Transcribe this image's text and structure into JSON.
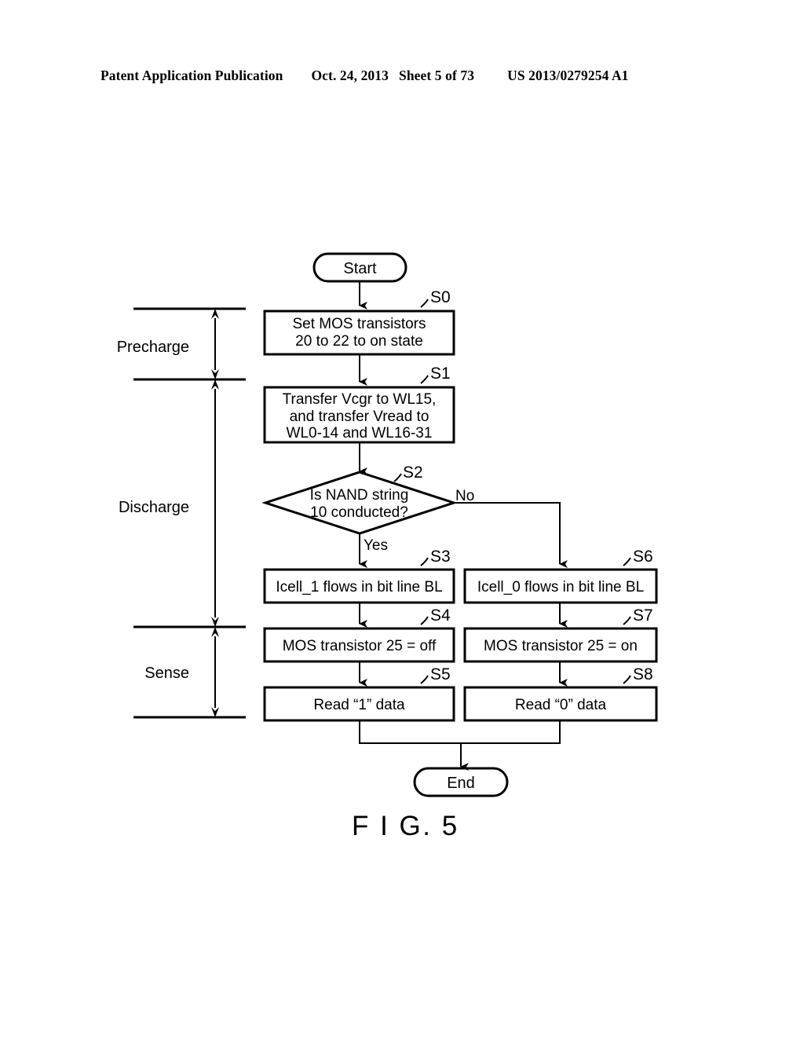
{
  "header": {
    "publication": "Patent Application Publication",
    "date": "Oct. 24, 2013",
    "sheet": "Sheet 5 of 73",
    "patent_number": "US 2013/0279254 A1"
  },
  "figure": {
    "caption": "F I G. 5",
    "colors": {
      "ink": "#000000",
      "background": "#ffffff"
    },
    "phases": [
      {
        "id": "precharge",
        "label": "Precharge"
      },
      {
        "id": "discharge",
        "label": "Discharge"
      },
      {
        "id": "sense",
        "label": "Sense"
      }
    ],
    "terminals": {
      "start": "Start",
      "end": "End"
    },
    "nodes": [
      {
        "id": "S0",
        "tag": "S0",
        "type": "process",
        "lines": [
          "Set MOS transistors",
          "20 to 22 to on state"
        ]
      },
      {
        "id": "S1",
        "tag": "S1",
        "type": "process",
        "lines": [
          "Transfer Vcgr to WL15,",
          "and transfer Vread to",
          "WL0-14 and WL16-31"
        ]
      },
      {
        "id": "S2",
        "tag": "S2",
        "type": "decision",
        "lines": [
          "Is NAND string",
          "10 conducted?"
        ]
      },
      {
        "id": "S3",
        "tag": "S3",
        "type": "process",
        "lines": [
          "Icell_1 flows in bit line BL"
        ]
      },
      {
        "id": "S4",
        "tag": "S4",
        "type": "process",
        "lines": [
          "MOS transistor 25 = off"
        ]
      },
      {
        "id": "S5",
        "tag": "S5",
        "type": "process",
        "lines": [
          "Read “1” data"
        ]
      },
      {
        "id": "S6",
        "tag": "S6",
        "type": "process",
        "lines": [
          "Icell_0 flows in bit line BL"
        ]
      },
      {
        "id": "S7",
        "tag": "S7",
        "type": "process",
        "lines": [
          "MOS transistor 25 = on"
        ]
      },
      {
        "id": "S8",
        "tag": "S8",
        "type": "process",
        "lines": [
          "Read “0” data"
        ]
      }
    ],
    "branch_labels": {
      "yes": "Yes",
      "no": "No"
    }
  }
}
